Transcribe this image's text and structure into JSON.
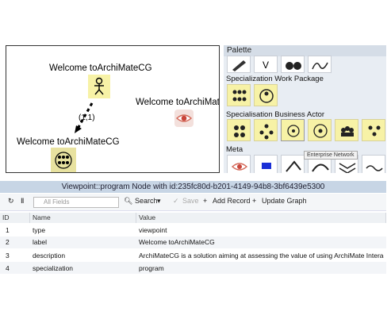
{
  "canvas": {
    "node1_title": "Welcome toArchiMateCG",
    "node2_title": "Welcome toArchiMateCG",
    "node3_title": "Welcome toArchiMateCG",
    "edge_label": "(1,1)"
  },
  "palette": {
    "header": "Palette",
    "sections": [
      "Specialization Work Package",
      "Specialisation Business Actor",
      "Meta"
    ],
    "tooltip": "Enterprise Network"
  },
  "grid": {
    "title": "Viewpoint::program Node with id:235fc80d-b201-4149-94b8-3bf6439e5300",
    "toolbar": {
      "search_placeholder": "All Fields",
      "search_label": "Search",
      "save_label": "Save",
      "add_record_label": "Add Record",
      "update_graph_label": "Update Graph"
    },
    "columns": [
      "ID",
      "Name",
      "Value"
    ],
    "rows": [
      {
        "id": "1",
        "name": "type",
        "value": "viewpoint"
      },
      {
        "id": "2",
        "name": "label",
        "value": "Welcome toArchiMateCG"
      },
      {
        "id": "3",
        "name": "description",
        "value": "ArchiMateCG is a solution aiming at assessing the value of using ArchiMate Interactiv..."
      },
      {
        "id": "4",
        "name": "specialization",
        "value": "program"
      }
    ]
  }
}
